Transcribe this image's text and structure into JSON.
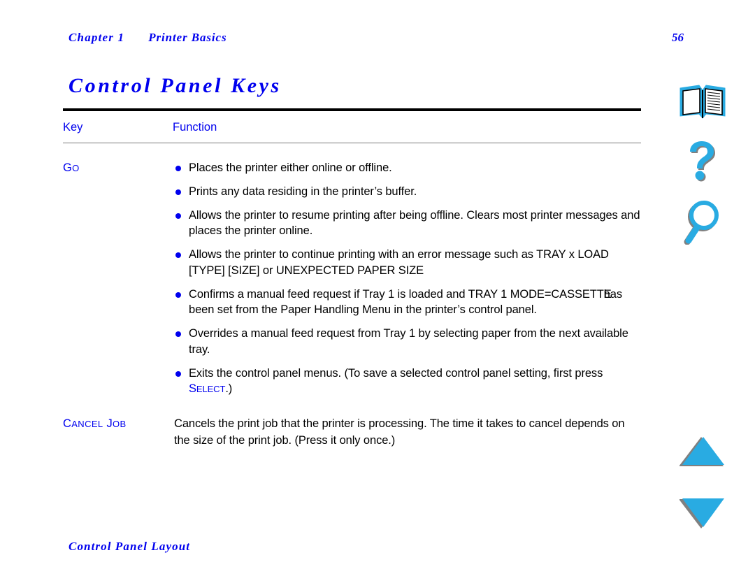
{
  "document": {
    "header": {
      "chapter": "Chapter 1",
      "section": "Printer Basics",
      "page_number": "56"
    },
    "title": "Control Panel Keys",
    "footer": "Control Panel Layout"
  },
  "table": {
    "headers": {
      "key": "Key",
      "function": "Function"
    },
    "rows": [
      {
        "key_first": "G",
        "key_rest": "O",
        "key_full": "Go",
        "bullets": [
          {
            "text": "Places the printer either online or offline."
          },
          {
            "text": "Prints any data residing in the printer’s buffer."
          },
          {
            "text": "Allows the printer to resume printing after being offline. Clears most printer messages and places the printer online."
          },
          {
            "text": "Allows the printer to continue printing with an error message such as TRAY x LOAD [TYPE] [SIZE] or UNEXPECTED PAPER SIZE"
          },
          {
            "part_a": "Confirms a manual feed request if Tray 1 is loaded and TRAY  1 MODE=",
            "part_b": "CASSETTE",
            "part_c": "has been set from the Paper Handling Menu in the printer’s control panel."
          },
          {
            "text": "Overrides a manual feed request from Tray 1 by selecting paper from the next available tray."
          },
          {
            "part_a": "Exits the control panel menus. (To save a selected control panel setting, first press ",
            "inline_key_first": "S",
            "inline_key_rest": "ELECT",
            "part_c": ".)"
          }
        ]
      },
      {
        "key_first": "C",
        "key_rest": "ANCEL",
        "key_first_2": "J",
        "key_rest_2": "OB",
        "key_full": "Cancel Job",
        "paragraph": "Cancels the print job that the printer is processing. The time it takes to cancel depends on the size of the print job. (Press it only once.)"
      }
    ]
  },
  "nav_rail": {
    "items": [
      {
        "name": "book-icon",
        "label": "Contents"
      },
      {
        "name": "question-mark-icon",
        "label": "Help"
      },
      {
        "name": "magnifier-icon",
        "label": "Search"
      },
      {
        "name": "triangle-up-icon",
        "label": "Previous page"
      },
      {
        "name": "triangle-down-icon",
        "label": "Next page"
      }
    ]
  },
  "colors": {
    "link_blue": "#0000ee",
    "icon_cyan": "#29ABE2",
    "icon_shadow": "#808080",
    "rule_black": "#000000",
    "rule_gray": "#7a7a7a",
    "text_black": "#000000"
  }
}
